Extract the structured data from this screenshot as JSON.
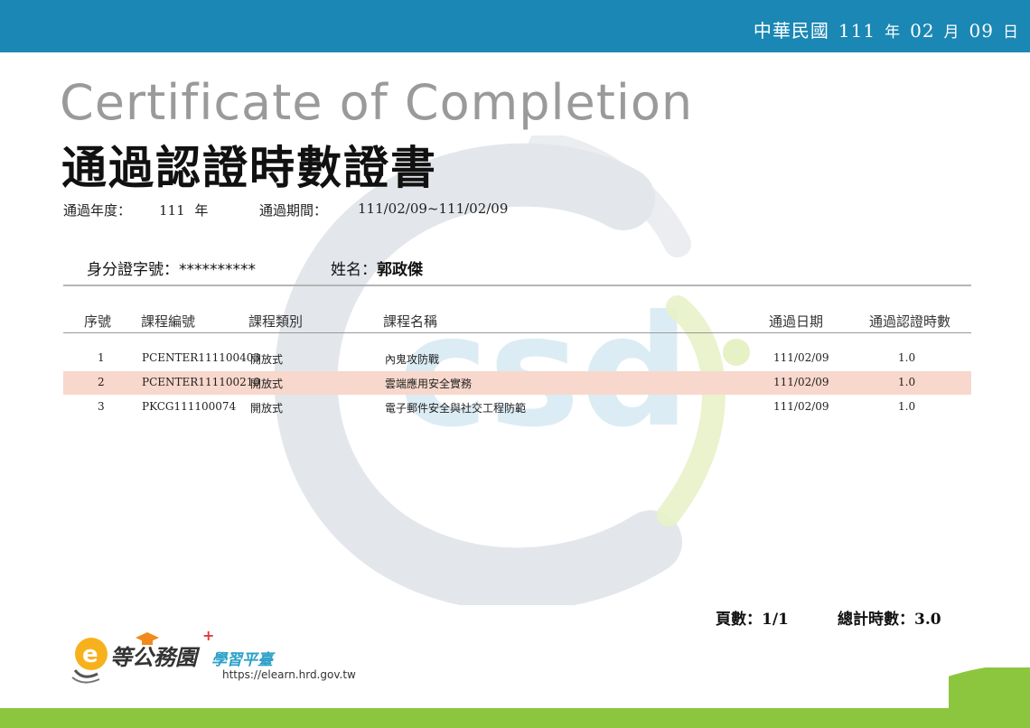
{
  "header": {
    "date_prefix": "中華民國",
    "year": "111",
    "year_unit": "年",
    "month": "02",
    "month_unit": "月",
    "day": "09",
    "day_unit": "日"
  },
  "title": {
    "english": "Certificate of Completion",
    "chinese": "通過認證時數證書"
  },
  "meta": {
    "year_label": "通過年度：",
    "year_value": "111",
    "year_unit": "年",
    "period_label": "通過期間：",
    "period_value": "111/02/09~111/02/09"
  },
  "person": {
    "id_label": "身分證字號：",
    "id_value": "**********",
    "name_label": "姓名：",
    "name_value": "郭政傑"
  },
  "table": {
    "headers": [
      "序號",
      "課程編號",
      "課程類別",
      "課程名稱",
      "通過日期",
      "通過認證時數"
    ],
    "rows": [
      {
        "no": "1",
        "code": "PCENTER111100403",
        "category": "開放式",
        "name": "內鬼攻防戰",
        "date": "111/02/09",
        "hours": "1.0",
        "highlight": false
      },
      {
        "no": "2",
        "code": "PCENTER111100210",
        "category": "開放式",
        "name": "雲端應用安全實務",
        "date": "111/02/09",
        "hours": "1.0",
        "highlight": true
      },
      {
        "no": "3",
        "code": "PKCG111100074",
        "category": "開放式",
        "name": "電子郵件安全與社交工程防範",
        "date": "111/02/09",
        "hours": "1.0",
        "highlight": false
      }
    ]
  },
  "summary": {
    "pages_label": "頁數：",
    "pages_value": "1/1",
    "total_label": "總計時數：",
    "total_value": "3.0"
  },
  "logo": {
    "name": "等公務園",
    "sub": "學習平臺",
    "url": "https://elearn.hrd.gov.tw"
  },
  "colors": {
    "top_band": "#1b87b4",
    "bottom_band": "#8cc63f",
    "highlight_row": "#f8d8cc"
  }
}
